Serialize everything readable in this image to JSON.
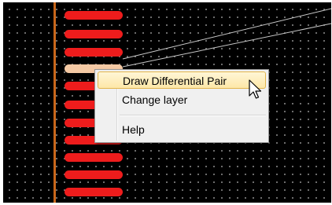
{
  "context_menu": {
    "items": [
      {
        "label": "Draw Differential Pair",
        "highlighted": true
      },
      {
        "label": "Change layer",
        "highlighted": false
      },
      {
        "label": "Help",
        "highlighted": false
      }
    ]
  },
  "colors": {
    "board_background": "#000000",
    "pad": "#ee1c1c",
    "selected_pad": "#f4c9a4",
    "track": "#c8661a",
    "menu_highlight": "#fde7a8"
  }
}
